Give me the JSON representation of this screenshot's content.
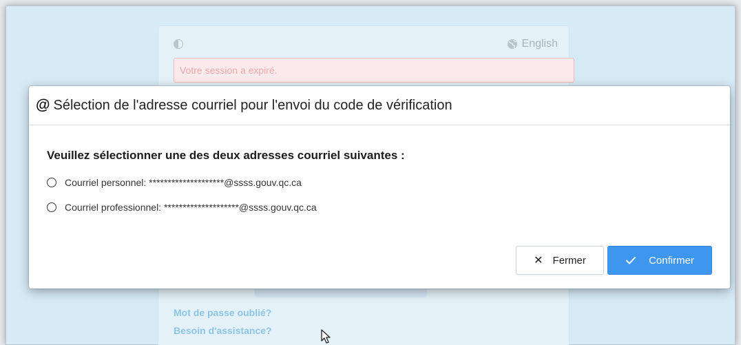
{
  "login": {
    "language_link": "English",
    "session_message": "Votre session a expiré.",
    "forgot_password": "Mot de passe oublié?",
    "need_help": "Besoin d'assistance?"
  },
  "modal": {
    "title_icon": "@",
    "title": "Sélection de l'adresse courriel pour l'envoi du code de vérification",
    "question": "Veuillez sélectionner une des deux adresses courriel suivantes :",
    "options": [
      {
        "label": "Courriel personnel: ********************@ssss.gouv.qc.ca",
        "selected": false
      },
      {
        "label": "Courriel professionnel: ********************@ssss.gouv.qc.ca",
        "selected": false
      }
    ],
    "close_button": "Fermer",
    "confirm_button": "Confirmer"
  },
  "icons": {
    "contrast": "contrast-icon",
    "language": "globe-icon",
    "close": "close-icon",
    "confirm": "check-icon",
    "cursor": "mouse-cursor-icon"
  },
  "colors": {
    "confirm_button": "#3f96ee",
    "background": "#d7ebf7",
    "alert_border": "#f3b9bd",
    "link": "#8dc4e3"
  }
}
